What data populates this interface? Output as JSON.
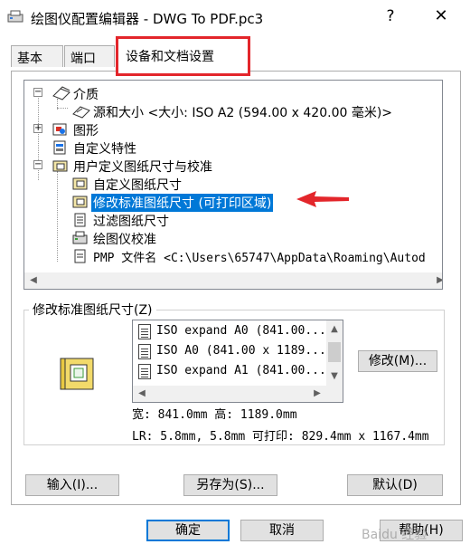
{
  "window": {
    "title": "绘图仪配置编辑器 - DWG To PDF.pc3",
    "help_label": "?",
    "close_label": "✕"
  },
  "tabs": [
    {
      "label": "基本"
    },
    {
      "label": "端口"
    },
    {
      "label": "设备和文档设置",
      "active": true
    }
  ],
  "tree": {
    "items": [
      {
        "label": "介质",
        "expander": "−"
      },
      {
        "label": "源和大小 <大小: ISO A2 (594.00 x 420.00 毫米)>"
      },
      {
        "label": "图形",
        "expander": "+"
      },
      {
        "label": "自定义特性"
      },
      {
        "label": "用户定义图纸尺寸与校准",
        "expander": "−"
      },
      {
        "label": "自定义图纸尺寸"
      },
      {
        "label": "修改标准图纸尺寸 (可打印区域)",
        "selected": true
      },
      {
        "label": "过滤图纸尺寸"
      },
      {
        "label": "绘图仪校准"
      },
      {
        "label": "PMP 文件名 <C:\\Users\\65747\\AppData\\Roaming\\Autod"
      }
    ]
  },
  "modify_group": {
    "label": "修改标准图纸尺寸(Z)",
    "list": [
      "ISO expand A0 (841.00...",
      "ISO A0 (841.00 x 1189...",
      "ISO expand A1 (841.00..."
    ],
    "modify_button": "修改(M)...",
    "size_text": "宽: 841.0mm 高: 1189.0mm",
    "margin_text": "LR: 5.8mm, 5.8mm  可打印: 829.4mm x 1167.4mm"
  },
  "buttons": {
    "import": "输入(I)...",
    "save_as": "另存为(S)...",
    "default": "默认(D)",
    "ok": "确定",
    "cancel": "取消",
    "help": "帮助(H)"
  },
  "watermark": "Baidu 经验",
  "colors": {
    "selection": "#0078d7",
    "annotation_red": "#e3262b"
  }
}
